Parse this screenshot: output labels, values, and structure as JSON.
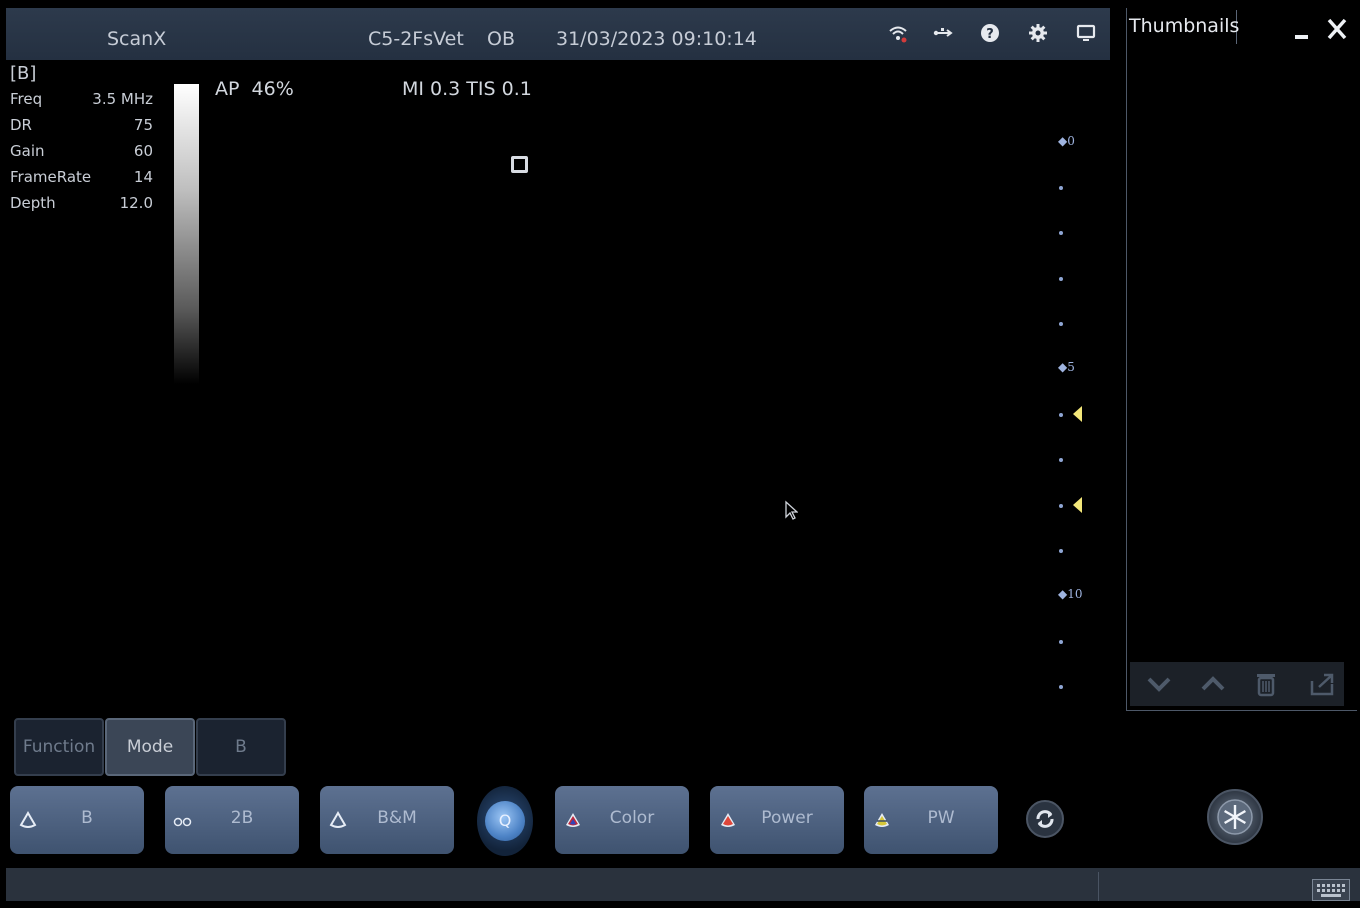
{
  "header": {
    "app_name": "ScanX",
    "probe": "C5-2FsVet",
    "exam": "OB",
    "datetime": "31/03/2023 09:10:14"
  },
  "params": {
    "mode_tag": "[B]",
    "rows": [
      {
        "label": "Freq",
        "value": "3.5 MHz"
      },
      {
        "label": "DR",
        "value": "75"
      },
      {
        "label": "Gain",
        "value": "60"
      },
      {
        "label": "FrameRate",
        "value": "14"
      },
      {
        "label": "Depth",
        "value": "12.0"
      }
    ]
  },
  "acoustic": {
    "ap": "AP  46%",
    "mi_tis": "MI 0.3 TIS 0.1"
  },
  "depth_scale": {
    "labels": [
      "0",
      "5",
      "10"
    ]
  },
  "thumbnails": {
    "title": "Thumbnails"
  },
  "tabs": {
    "function": "Function",
    "mode": "Mode",
    "b": "B"
  },
  "modes": {
    "b": "B",
    "twob": "2B",
    "bm": "B&M",
    "q": "Q",
    "color": "Color",
    "power": "Power",
    "pw": "PW"
  },
  "icons": {
    "wifi": "wifi-icon",
    "usb": "usb-icon",
    "help": "help-icon",
    "settings": "gear-icon",
    "display": "monitor-icon",
    "freeze": "snowflake-icon"
  },
  "colors": {
    "header": "#2d3a4c",
    "mode_button": "#5d7191",
    "focus_marker": "#f3e77a",
    "scale": "#9fb4e0"
  }
}
